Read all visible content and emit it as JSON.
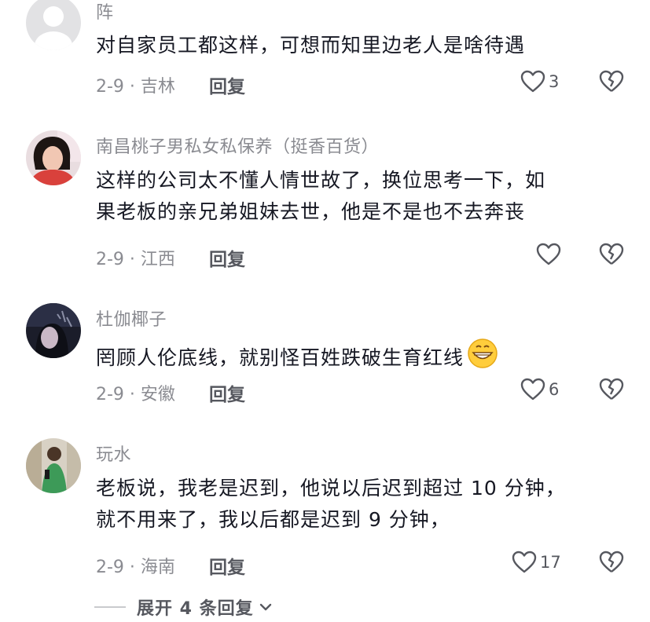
{
  "comments": [
    {
      "username": "阵",
      "text_lines": [
        "对自家员工都这样，可想而知里边老人是啥待遇"
      ],
      "meta": "2-9 · 吉林",
      "reply_label": "回复",
      "likes": "3",
      "avatar": "default-avatar"
    },
    {
      "username": "南昌桃子男私女私保养（挺香百货）",
      "text_lines": [
        "这样的公司太不懂人情世故了，换位思考一下，如",
        "果老板的亲兄弟姐妹去世，他是不是也不去奔丧"
      ],
      "meta": "2-9 · 江西",
      "reply_label": "回复",
      "likes": "",
      "avatar": "photo-avatar-woman"
    },
    {
      "username": "杜伽椰子",
      "text_lines": [
        "罔顾人伦底线，就别怪百姓跌破生育红线"
      ],
      "emoji": "grinning-emoji",
      "meta": "2-9 · 安徽",
      "reply_label": "回复",
      "likes": "6",
      "avatar": "photo-avatar-dark"
    },
    {
      "username": "玩水",
      "text_lines": [
        "老板说，我老是迟到，他说以后迟到超过 10 分钟，",
        "就不用来了，我以后都是迟到 9 分钟，"
      ],
      "meta": "2-9 · 海南",
      "reply_label": "回复",
      "likes": "17",
      "avatar": "photo-avatar-man"
    }
  ],
  "expand_replies": "展开 4 条回复",
  "colors": {
    "text": "#161823",
    "secondary": "#8a8b91",
    "icon": "#56585f"
  }
}
